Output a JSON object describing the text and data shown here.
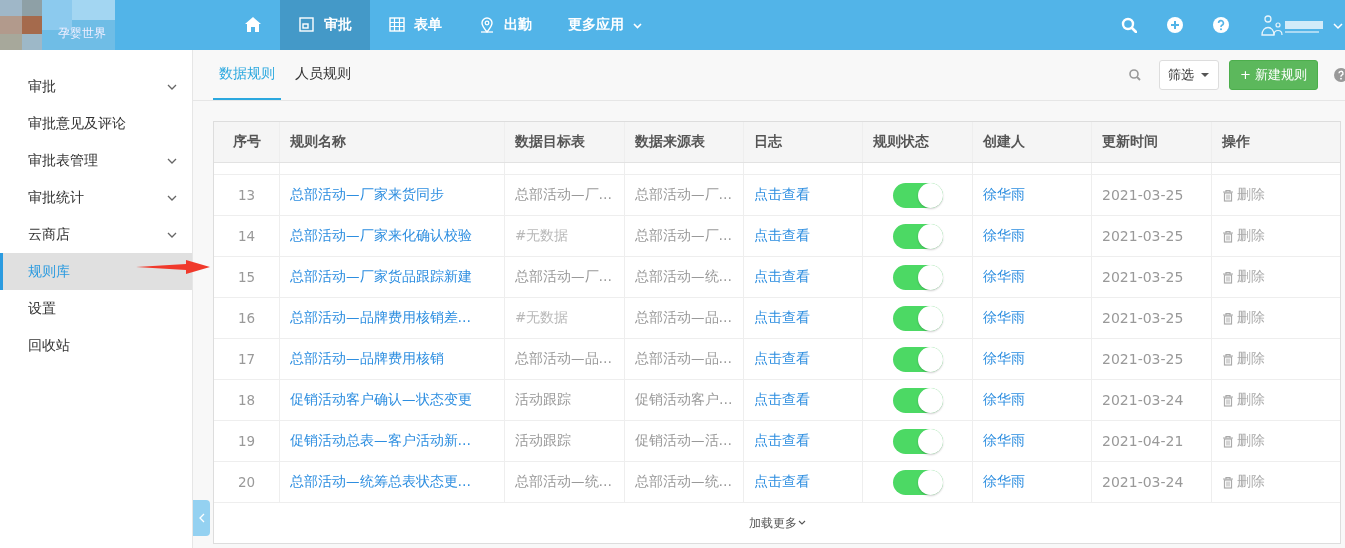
{
  "brand": {
    "name": "孕婴世界"
  },
  "nav": [
    {
      "kind": "home",
      "selected": false
    },
    {
      "kind": "approval",
      "label": "审批",
      "selected": true
    },
    {
      "kind": "form",
      "label": "表单",
      "selected": false
    },
    {
      "kind": "attendance",
      "label": "出勤",
      "selected": false
    },
    {
      "kind": "more",
      "label": "更多应用",
      "selected": false
    }
  ],
  "sidebar": {
    "items": [
      {
        "label": "审批",
        "expandable": true,
        "selected": false
      },
      {
        "label": "审批意见及评论",
        "expandable": false,
        "selected": false
      },
      {
        "label": "审批表管理",
        "expandable": true,
        "selected": false
      },
      {
        "label": "审批统计",
        "expandable": true,
        "selected": false
      },
      {
        "label": "云商店",
        "expandable": true,
        "selected": false
      },
      {
        "label": "规则库",
        "expandable": false,
        "selected": true
      },
      {
        "label": "设置",
        "expandable": false,
        "selected": false
      },
      {
        "label": "回收站",
        "expandable": false,
        "selected": false
      }
    ]
  },
  "tabs": [
    {
      "label": "数据规则",
      "selected": true
    },
    {
      "label": "人员规则",
      "selected": false
    }
  ],
  "toolbar": {
    "filter": "筛选",
    "new_button": "+ 新建规则"
  },
  "table": {
    "columns": [
      "序号",
      "规则名称",
      "数据目标表",
      "数据来源表",
      "日志",
      "规则状态",
      "创建人",
      "更新时间",
      "操作"
    ],
    "rows": [
      {
        "no": "13",
        "name": "总部活动—厂家来货同步",
        "target": "总部活动—厂…",
        "target_empty": false,
        "source": "总部活动—厂…",
        "log": "点击查看",
        "on": true,
        "creator": "徐华雨",
        "updated": "2021-03-25",
        "action": "删除"
      },
      {
        "no": "14",
        "name": "总部活动—厂家来化确认校验",
        "target": "#无数据",
        "target_empty": true,
        "source": "总部活动—厂…",
        "log": "点击查看",
        "on": true,
        "creator": "徐华雨",
        "updated": "2021-03-25",
        "action": "删除"
      },
      {
        "no": "15",
        "name": "总部活动—厂家货品跟踪新建",
        "target": "总部活动—厂…",
        "target_empty": false,
        "source": "总部活动—统…",
        "log": "点击查看",
        "on": true,
        "creator": "徐华雨",
        "updated": "2021-03-25",
        "action": "删除"
      },
      {
        "no": "16",
        "name": "总部活动—品牌费用核销差…",
        "target": "#无数据",
        "target_empty": true,
        "source": "总部活动—品…",
        "log": "点击查看",
        "on": true,
        "creator": "徐华雨",
        "updated": "2021-03-25",
        "action": "删除"
      },
      {
        "no": "17",
        "name": "总部活动—品牌费用核销",
        "target": "总部活动—品…",
        "target_empty": false,
        "source": "总部活动—品…",
        "log": "点击查看",
        "on": true,
        "creator": "徐华雨",
        "updated": "2021-03-25",
        "action": "删除"
      },
      {
        "no": "18",
        "name": "促销活动客户确认—状态变更",
        "target": "活动跟踪",
        "target_empty": false,
        "source": "促销活动客户…",
        "log": "点击查看",
        "on": true,
        "creator": "徐华雨",
        "updated": "2021-03-24",
        "action": "删除"
      },
      {
        "no": "19",
        "name": "促销活动总表—客户活动新…",
        "target": "活动跟踪",
        "target_empty": false,
        "source": "促销活动—活…",
        "log": "点击查看",
        "on": true,
        "creator": "徐华雨",
        "updated": "2021-04-21",
        "action": "删除"
      },
      {
        "no": "20",
        "name": "总部活动—统筹总表状态更…",
        "target": "总部活动—统…",
        "target_empty": false,
        "source": "总部活动—统…",
        "log": "点击查看",
        "on": true,
        "creator": "徐华雨",
        "updated": "2021-03-24",
        "action": "删除"
      }
    ],
    "load_more": "加载更多"
  }
}
